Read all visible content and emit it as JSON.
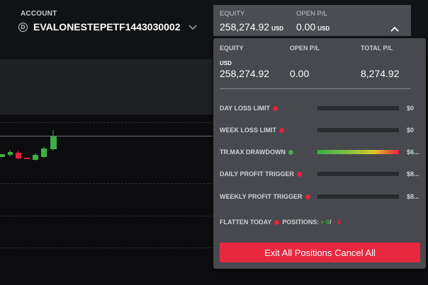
{
  "account": {
    "label": "ACCOUNT",
    "icon": "d-circle-icon",
    "name": "EVALONESTEPETF1443030002"
  },
  "equity_bar": {
    "equity_label": "EQUITY",
    "equity_value": "258,274.92",
    "equity_currency": "USD",
    "open_pl_label": "OPEN P/L",
    "open_pl_value": "0.00",
    "open_pl_currency": "USD"
  },
  "panel": {
    "headers": [
      "EQUITY",
      "OPEN P/L",
      "TOTAL P/L"
    ],
    "currency": "USD",
    "values": [
      "258,274.92",
      "0.00",
      "8,274.92"
    ],
    "metrics": [
      {
        "label": "DAY LOSS LIMIT",
        "status": "red",
        "value": "$0",
        "fill": 0
      },
      {
        "label": "WEEK LOSS LIMIT",
        "status": "red",
        "value": "$0",
        "fill": 0
      },
      {
        "label": "TR.MAX DRAWDOWN",
        "status": "green",
        "value": "$6...",
        "fill": 1
      },
      {
        "label": "DAILY PROFIT TRIGGER",
        "status": "red",
        "value": "$8...",
        "fill": 0
      },
      {
        "label": "WEEKLY PROFIT TRIGGER",
        "status": "red",
        "value": "$8...",
        "fill": 0
      }
    ],
    "flatten_label": "FLATTEN TODAY",
    "positions_label": "POSITIONS:",
    "positions_long": "+ 0",
    "positions_sep": "/",
    "positions_short": "- 0",
    "exit_button": "Exit All Positions Cancel All"
  },
  "colors": {
    "accent_red": "#e8273f",
    "status_red": "#e8203f",
    "status_green": "#3fae46",
    "panel_bg": "#47494e"
  }
}
